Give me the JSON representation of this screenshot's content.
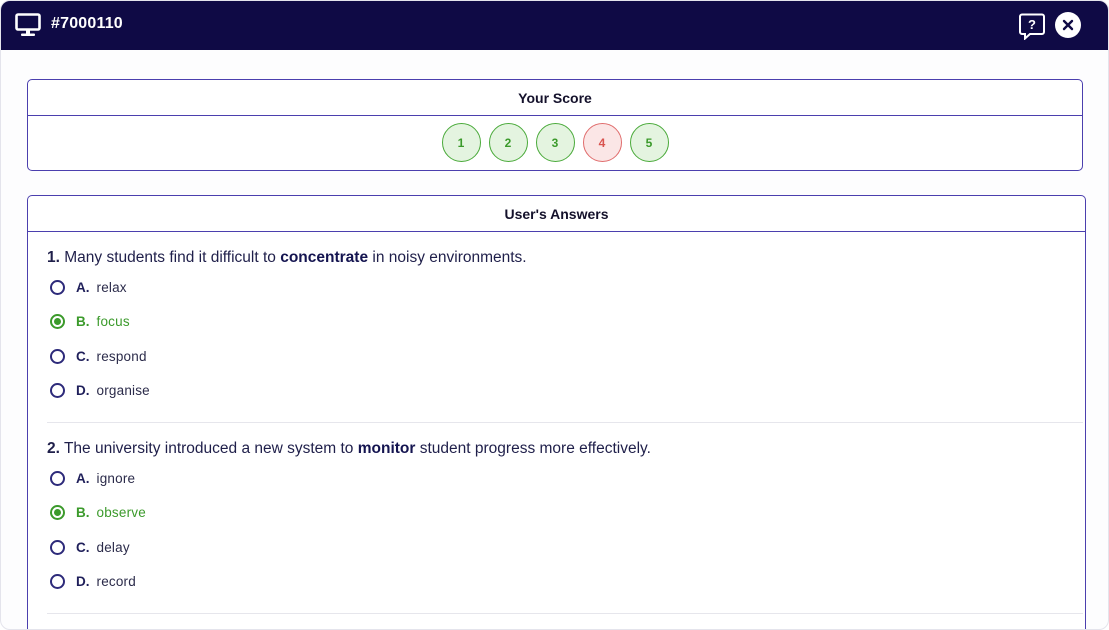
{
  "window": {
    "title": "#7000110"
  },
  "score": {
    "header": "Your Score",
    "items": [
      {
        "label": "1",
        "status": "correct"
      },
      {
        "label": "2",
        "status": "correct"
      },
      {
        "label": "3",
        "status": "correct"
      },
      {
        "label": "4",
        "status": "wrong"
      },
      {
        "label": "5",
        "status": "correct"
      }
    ]
  },
  "answers": {
    "header": "User's Answers",
    "questions": [
      {
        "number": "1.",
        "before": " Many students find it difficult to ",
        "keyword": "concentrate",
        "after": " in noisy environments.",
        "options": [
          {
            "letter": "A.",
            "text": "relax",
            "selected": false
          },
          {
            "letter": "B.",
            "text": "focus",
            "selected": true
          },
          {
            "letter": "C.",
            "text": "respond",
            "selected": false
          },
          {
            "letter": "D.",
            "text": "organise",
            "selected": false
          }
        ]
      },
      {
        "number": "2.",
        "before": " The university introduced a new system to ",
        "keyword": "monitor",
        "after": " student progress more effectively.",
        "options": [
          {
            "letter": "A.",
            "text": "ignore",
            "selected": false
          },
          {
            "letter": "B.",
            "text": "observe",
            "selected": true
          },
          {
            "letter": "C.",
            "text": "delay",
            "selected": false
          },
          {
            "letter": "D.",
            "text": "record",
            "selected": false
          }
        ]
      }
    ]
  },
  "colors": {
    "titlebar": "#0f0a45",
    "panel_border": "#4b3fae",
    "correct": "#3b9a2b",
    "wrong": "#d9534f"
  },
  "icons": {
    "title": "monitor-icon",
    "help": "help-icon",
    "close": "close-icon"
  }
}
